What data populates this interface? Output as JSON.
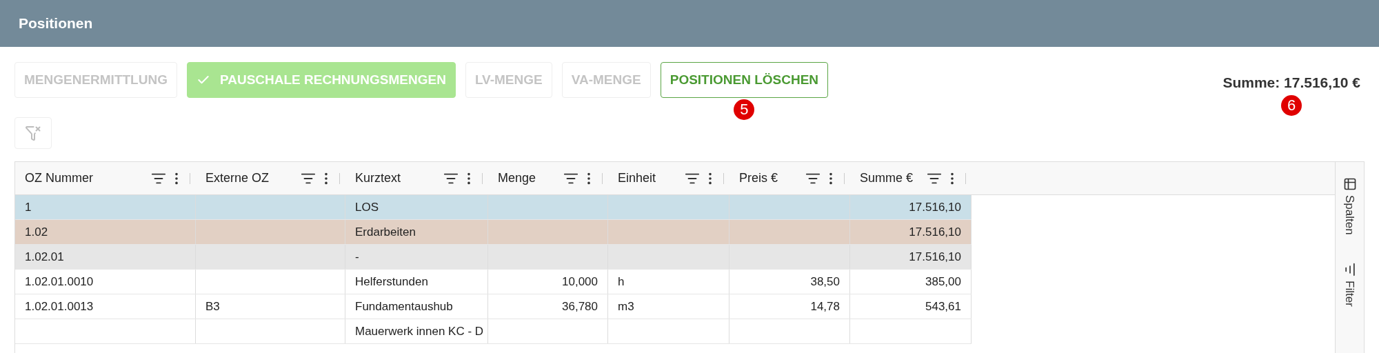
{
  "header": {
    "title": "Positionen"
  },
  "toolbar": {
    "buttons": [
      {
        "label": "MENGENERMITTLUNG",
        "disabled": true,
        "selected": false
      },
      {
        "label": "PAUSCHALE RECHNUNGSMENGEN",
        "disabled": false,
        "selected": true
      },
      {
        "label": "LV-MENGE",
        "disabled": true,
        "selected": false
      },
      {
        "label": "VA-MENGE",
        "disabled": true,
        "selected": false
      },
      {
        "label": "POSITIONEN LÖSCHEN",
        "disabled": false,
        "selected": false,
        "marker": "5"
      }
    ],
    "clear_filter": {
      "disabled": true
    }
  },
  "summary": {
    "text": "Summe: 17.516,10 €",
    "marker": "6"
  },
  "table": {
    "columns": [
      "OZ Nummer",
      "Externe OZ",
      "Kurztext",
      "Menge",
      "Einheit",
      "Preis €",
      "Summe €"
    ],
    "rows": [
      {
        "kind": "los",
        "cells": [
          "1",
          "",
          "LOS",
          "",
          "",
          "",
          "17.516,10"
        ]
      },
      {
        "kind": "title",
        "cells": [
          "1.02",
          "",
          "Erdarbeiten",
          "",
          "",
          "",
          "17.516,10"
        ]
      },
      {
        "kind": "subtitle",
        "cells": [
          "1.02.01",
          "",
          "-",
          "",
          "",
          "",
          "17.516,10"
        ]
      },
      {
        "kind": "position",
        "cells": [
          "1.02.01.0010",
          "",
          "Helferstunden",
          "10,000",
          "h",
          "38,50",
          "385,00"
        ]
      },
      {
        "kind": "position",
        "cells": [
          "1.02.01.0013",
          "B3",
          "Fundamentaushub",
          "36,780",
          "m3",
          "14,78",
          "543,61"
        ]
      },
      {
        "kind": "position",
        "cells": [
          "",
          "",
          "Mauerwerk innen KC - D",
          "",
          "",
          "",
          ""
        ]
      }
    ]
  },
  "side_panel": {
    "tabs": [
      "Spalten",
      "Filter"
    ]
  }
}
